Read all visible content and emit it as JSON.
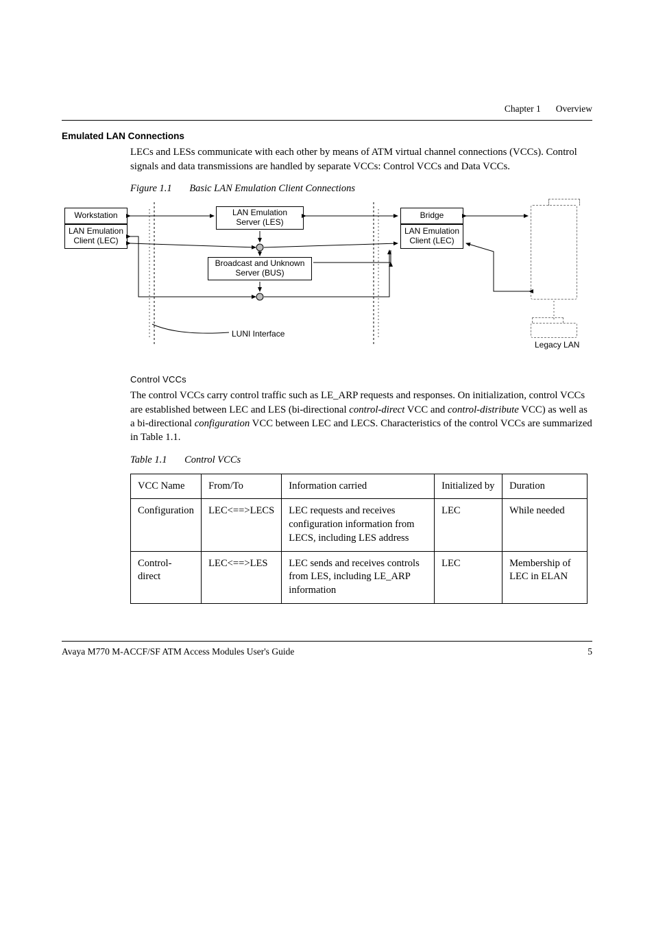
{
  "running": {
    "chapter": "Chapter 1",
    "title": "Overview"
  },
  "section": {
    "heading": "Emulated LAN Connections"
  },
  "intro": "LECs and LESs communicate with each other by means of ATM virtual channel connections (VCCs). Control signals and data transmissions are handled by separate VCCs: Control VCCs and Data VCCs.",
  "figure": {
    "label": "Figure 1.1",
    "caption": "Basic LAN Emulation Client Connections"
  },
  "diagram": {
    "workstation": "Workstation",
    "leclient_left_a": "LAN Emulation",
    "leclient_left_b": "Client (LEC)",
    "les_a": "LAN Emulation",
    "les_b": "Server (LES)",
    "bus_a": "Broadcast and Unknown",
    "bus_b": "Server (BUS)",
    "bridge": "Bridge",
    "leclient_right_a": "LAN Emulation",
    "leclient_right_b": "Client (LEC)",
    "luni": "LUNI Interface",
    "legacy": "Legacy LAN"
  },
  "control": {
    "heading": "Control VCCs",
    "para_pre": "The control VCCs carry control traffic such as LE_ARP requests and responses. On initialization, control VCCs are established between LEC and LES (bi-directional ",
    "term1": "control-direct",
    "mid1": " VCC and ",
    "term2": "control-distribute",
    "mid2": " VCC) as well as a bi-directional ",
    "term3": "configuration",
    "para_post": " VCC between LEC and LECS. Characteristics of the control VCCs are summarized in Table 1.1."
  },
  "tablecap": {
    "label": "Table 1.1",
    "caption": "Control VCCs"
  },
  "table": {
    "headers": {
      "c1": "VCC Name",
      "c2": "From/To",
      "c3": "Information carried",
      "c4": "Initialized by",
      "c5": "Duration"
    },
    "rows": [
      {
        "c1": "Configuration",
        "c2": "LEC<==>LECS",
        "c3": "LEC requests and receives configuration information from LECS, including LES address",
        "c4": "LEC",
        "c5": "While needed"
      },
      {
        "c1": "Control-direct",
        "c2": "LEC<==>LES",
        "c3": "LEC sends and receives controls from LES, including LE_ARP information",
        "c4": "LEC",
        "c5": "Membership of LEC in ELAN"
      }
    ]
  },
  "footer": {
    "left": "Avaya M770 M-ACCF/SF ATM Access Modules User's Guide",
    "right": "5"
  }
}
